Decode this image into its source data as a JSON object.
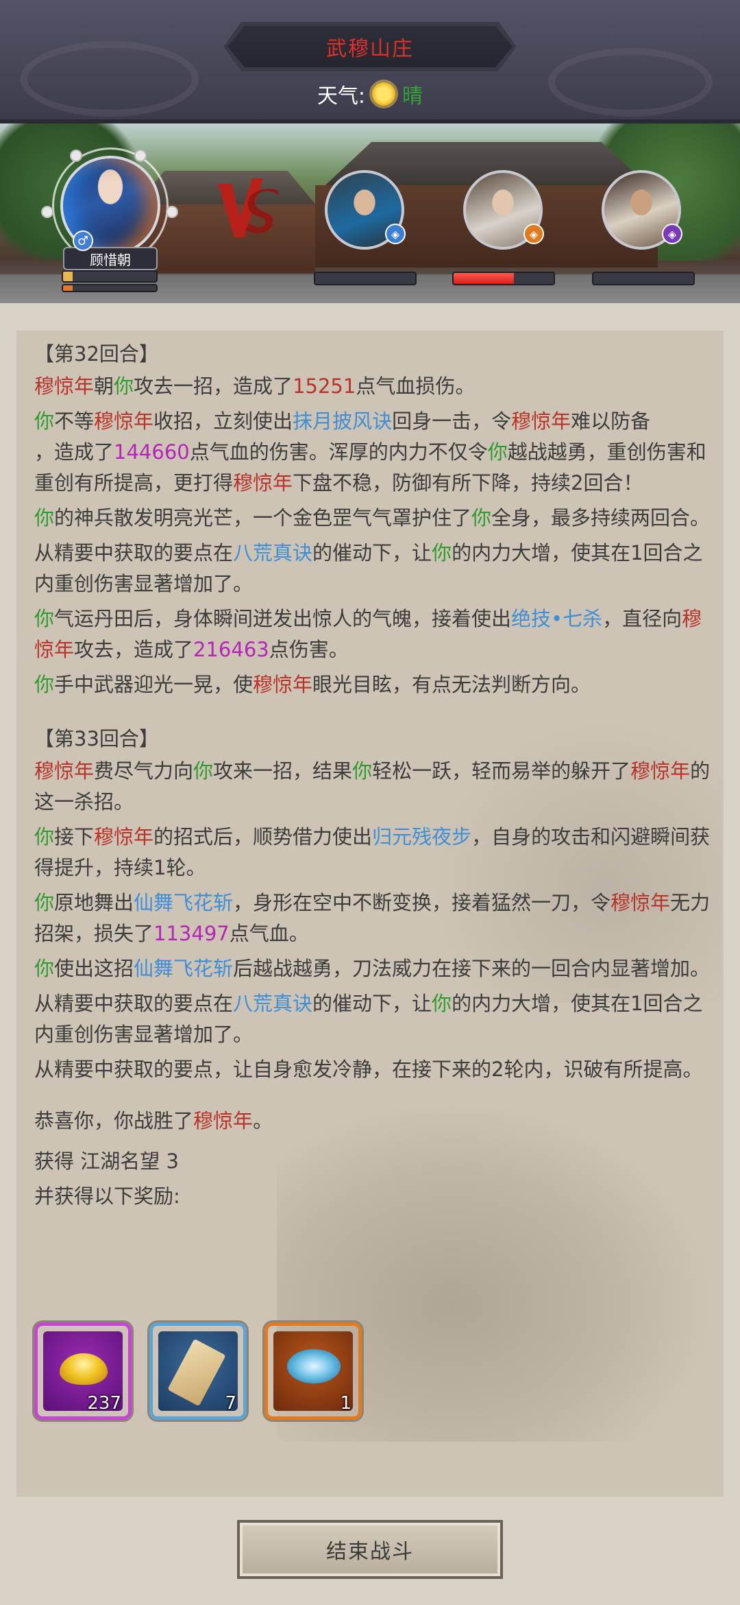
{
  "header": {
    "location": "武穆山庄",
    "weather_label": "天气:",
    "weather_icon": "sun-icon",
    "weather_value": "晴"
  },
  "battle": {
    "player": {
      "name": "顾惜朝",
      "hp_fraction": 0.1,
      "mp_fraction": 0.1
    },
    "vs_icon": "vs-icon",
    "enemies": [
      {
        "hp_fraction": 0.0,
        "badge_icon": "water-element-icon"
      },
      {
        "hp_fraction": 0.6,
        "badge_icon": "fire-element-icon"
      },
      {
        "hp_fraction": 0.0,
        "badge_icon": "poison-element-icon"
      }
    ]
  },
  "log": {
    "round32": {
      "title": "【第32回合】",
      "l1": [
        "穆惊年",
        "朝",
        "你",
        "攻去一招，造成了",
        "15251",
        "点气血损伤。"
      ],
      "l2": [
        "你",
        "不等",
        "穆惊年",
        "收招，立刻使出",
        "抹月披风诀",
        "回身一击，令",
        "穆惊年",
        "难以防备",
        "，造成了",
        "144660",
        "点气血的伤害。浑厚的内力不仅令",
        "你",
        "越战越勇，重创伤害和重创有所提高，更打得",
        "穆惊年",
        "下盘不稳，防御有所下降，持续2回合！"
      ],
      "l3": [
        "你",
        "的神兵散发明亮光芒，一个金色罡气气罩护住了",
        "你",
        "全身，最多持续两回合。"
      ],
      "l4": [
        "从精要中获取的要点在",
        "八荒真诀",
        "的催动下，让",
        "你",
        "的内力大增，使其在1回合之内重创伤害显著增加了。"
      ],
      "l5": [
        "你",
        "气运丹田后，身体瞬间迸发出惊人的气魄，接着使出",
        "绝技•七杀",
        "，直径向",
        "穆惊年",
        "攻去，造成了",
        "216463",
        "点伤害。"
      ],
      "l6": [
        "你",
        "手中武器迎光一晃，使",
        "穆惊年",
        "眼光目眩，有点无法判断方向。"
      ]
    },
    "round33": {
      "title": "【第33回合】",
      "l1": [
        "穆惊年",
        "费尽气力向",
        "你",
        "攻来一招，结果",
        "你",
        "轻松一跃，轻而易举的躲开了",
        "穆惊年",
        "的这一杀招。"
      ],
      "l2": [
        "你",
        "接下",
        "穆惊年",
        "的招式后，顺势借力使出",
        "归元残夜步",
        "，自身的攻击和闪避瞬间获得提升，持续1轮。"
      ],
      "l3": [
        "你",
        "原地舞出",
        "仙舞飞花斩",
        "，身形在空中不断变换，接着猛然一刀，令",
        "穆惊年",
        "无力招架，损失了",
        "113497",
        "点气血。"
      ],
      "l4": [
        "你",
        "使出这招",
        "仙舞飞花斩",
        "后越战越勇，刀法威力在接下来的一回合内显著增加。"
      ],
      "l5": [
        "从精要中获取的要点在",
        "八荒真诀",
        "的催动下，让",
        "你",
        "的内力大增，使其在1回合之内重创伤害显著增加了。"
      ],
      "l6": "从精要中获取的要点，让自身愈发冷静，在接下来的2轮内，识破有所提高。"
    },
    "victory": [
      "恭喜你，你战胜了",
      "穆惊年",
      "。"
    ],
    "reputation": {
      "label": "获得",
      "value": "江湖名望 3"
    },
    "rewards_label": "并获得以下奖励:"
  },
  "rewards": [
    {
      "icon": "gold-ingot-icon",
      "count": "237"
    },
    {
      "icon": "scroll-icon",
      "count": "7"
    },
    {
      "icon": "cloud-orb-icon",
      "count": "1"
    }
  ],
  "footer": {
    "end_battle_label": "结束战斗"
  },
  "colors": {
    "enemy_name": "#b8332a",
    "player_ref": "#2e9b2e",
    "skill": "#3f8ed6",
    "damage": "#b425b8",
    "title": "#e0302a"
  }
}
